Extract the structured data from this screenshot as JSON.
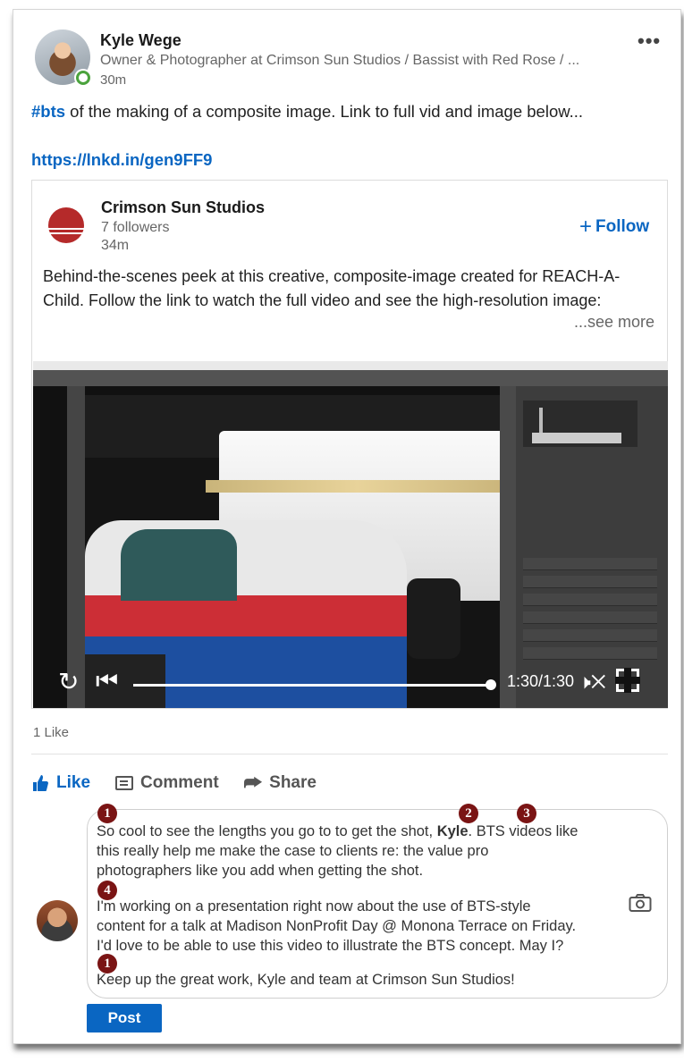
{
  "post": {
    "author_name": "Kyle Wege",
    "author_headline": "Owner & Photographer at Crimson Sun Studios / Bassist with Red Rose / ...",
    "author_time": "30m",
    "more_icon": "•••",
    "hashtag": "#bts",
    "body": " of the making of a composite image. Link to full vid and image below...",
    "link": "https://lnkd.in/gen9FF9"
  },
  "shared": {
    "company_name": "Crimson Sun Studios",
    "followers": "7 followers",
    "time": "34m",
    "follow_label": "Follow",
    "follow_icon": "+",
    "body": "Behind-the-scenes peek at this creative, composite-image created for REACH-A-Child. Follow the link to watch the full video and see the high-resolution image:",
    "see_more": "...see more",
    "logo_color": "#b52a2a"
  },
  "video": {
    "time": "1:30/1:30",
    "progress_fraction": 1.0,
    "replay_icon": "↻",
    "prev_icon": "⏮",
    "mute_icon": "🕨✕"
  },
  "social": {
    "likes": "1 Like",
    "actions": {
      "like": "Like",
      "comment": "Comment",
      "share": "Share",
      "share_icon": "⮫"
    }
  },
  "comment": {
    "lines": [
      "So cool to see the lengths you go to to get the shot,",
      "Kyle",
      ". BTS videos like",
      "this really help me make the case to clients re: the value pro",
      "photographers like you add when getting the shot.",
      "I'm working on a presentation right now about the use of BTS-style",
      "content for a talk at Madison NonProfit Day @ Monona Terrace on Friday.",
      "I'd love to be able to use this video to illustrate the BTS concept. May I?",
      "Keep up the great work, Kyle and team at Crimson Sun Studios!"
    ],
    "markers": [
      "1",
      "2",
      "3",
      "4",
      "1"
    ],
    "marker_color": "#7a1414",
    "post_button": "Post"
  },
  "colors": {
    "accent": "#0a66c2",
    "online": "#4ba33d"
  }
}
